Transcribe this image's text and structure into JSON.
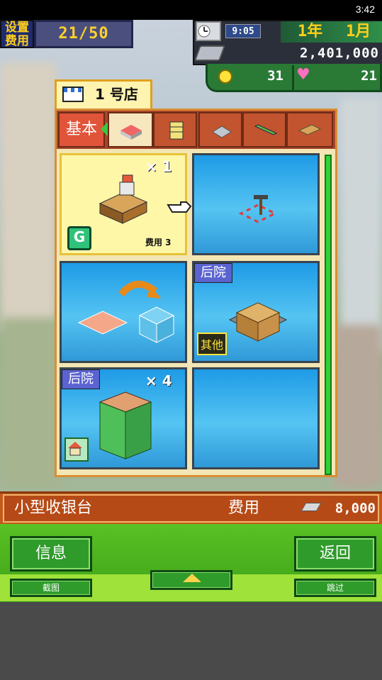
{
  "status_bar": {
    "time": "3:42"
  },
  "hud": {
    "setup_fee_label": "设置\n费用",
    "setup_fee_count": "21/50",
    "clock_time": "9:05",
    "year": "1年",
    "month": "1月",
    "money": "2,401,000",
    "coins": "31",
    "hearts": "21"
  },
  "store": {
    "name": "1 号店"
  },
  "category_tabs": [
    {
      "label": "基本",
      "active": true
    },
    {
      "icon": "counter-icon",
      "active": true
    },
    {
      "icon": "shelf-icon"
    },
    {
      "icon": "sofa-icon"
    },
    {
      "icon": "fence-icon"
    },
    {
      "icon": "bench-icon"
    }
  ],
  "items": [
    {
      "name": "cash-register",
      "count": "×  1",
      "cost_text": "费用 3",
      "badge": "G",
      "selected": true
    },
    {
      "name": "move-tool"
    },
    {
      "name": "convert-floor"
    },
    {
      "name": "storage-crates",
      "tag": "后院",
      "badge": "其他"
    },
    {
      "name": "trash-bin",
      "tag": "后院",
      "count": "×  4",
      "badge_icon": "house-icon"
    },
    {
      "name": "empty"
    }
  ],
  "selected_item": {
    "name": "小型收银台",
    "cost_label": "费用",
    "cost_value": "8,000"
  },
  "controls": {
    "info": "信息",
    "screenshot": "截图",
    "back": "返回",
    "skip": "跳过"
  },
  "colors": {
    "panel_border": "#d98f33",
    "tab_bg": "#a7452a",
    "cell_blue": "#1e9be6",
    "selected_cell": "#fff7a8",
    "green_btn": "#2f9b2b"
  }
}
